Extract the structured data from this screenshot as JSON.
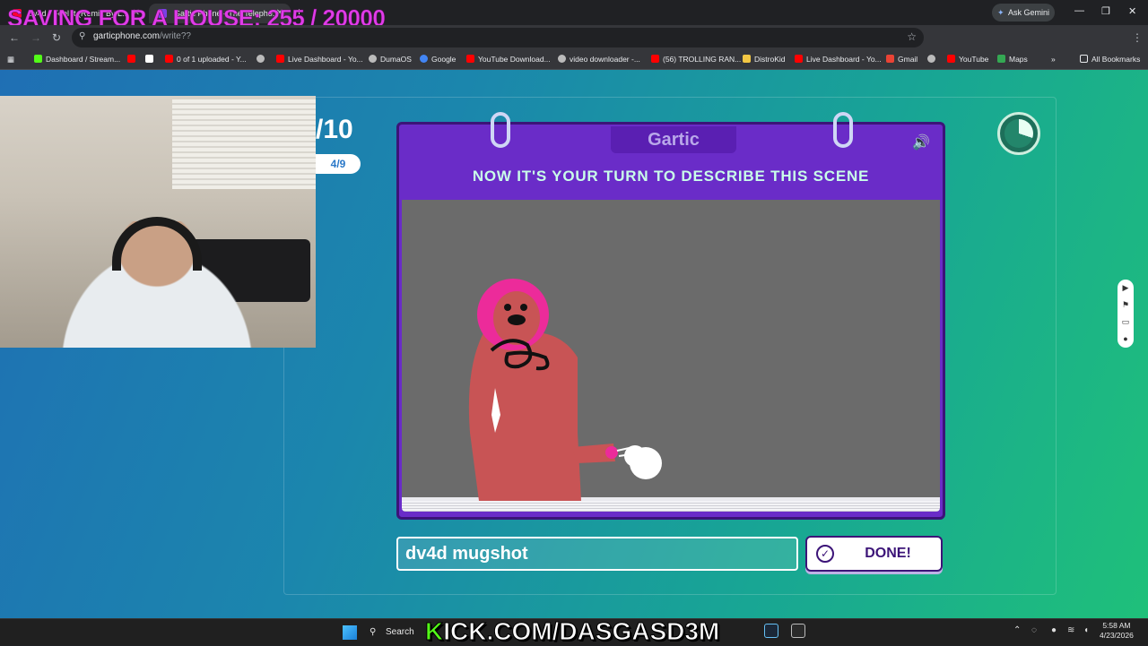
{
  "overlay": {
    "goal_text": "SAVING FOR A HOUSE: 255 / 20000",
    "kick_prefix": "K",
    "kick_rest": "ICK.COM/DASGASD3M"
  },
  "browser": {
    "tabs": [
      {
        "title": "dv4d - Feel It (Remix By L...",
        "favicon_color": "#ff0033"
      },
      {
        "title": "Gartic Phone - The Telepho...",
        "favicon_color": "#7b3fe4"
      }
    ],
    "ask_gemini": "Ask Gemini",
    "url_domain": "garticphone.com",
    "url_path": "/write??",
    "bookmarks": [
      {
        "label": "Dashboard / Stream...",
        "color": "#53fc18"
      },
      {
        "label": "",
        "color": "#ff0000"
      },
      {
        "label": "0 of 1 uploaded - Y...",
        "color": "#ff0000"
      },
      {
        "label": "",
        "color": "#bbbbbb"
      },
      {
        "label": "Live Dashboard - Yo...",
        "color": "#ff0000"
      },
      {
        "label": "DumaOS",
        "color": "#bbbbbb"
      },
      {
        "label": "Google",
        "color": "#4285f4"
      },
      {
        "label": "YouTube Download...",
        "color": "#ff0000"
      },
      {
        "label": "video downloader -...",
        "color": "#bbbbbb"
      },
      {
        "label": "(56) TROLLING RAN...",
        "color": "#ff0000"
      },
      {
        "label": "DistroKid",
        "color": "#f2c744"
      },
      {
        "label": "Live Dashboard - Yo...",
        "color": "#ff0000"
      },
      {
        "label": "Gmail",
        "color": "#ea4335"
      },
      {
        "label": "",
        "color": "#bbbbbb"
      },
      {
        "label": "YouTube",
        "color": "#ff0000"
      },
      {
        "label": "Maps",
        "color": "#34a853"
      }
    ],
    "all_bookmarks": "All Bookmarks"
  },
  "game": {
    "round_total": "/10",
    "round_progress": "4/9",
    "logo": "Gartic",
    "prompt": "NOW IT'S YOUR TURN TO DESCRIBE THIS SCENE",
    "answer_value": "dv4d mugshot",
    "done_label": "DONE!",
    "timer_elapsed_fraction": 0.3
  },
  "taskbar": {
    "search_label": "Search",
    "time": "5:58 AM",
    "date": "4/23/2026"
  }
}
